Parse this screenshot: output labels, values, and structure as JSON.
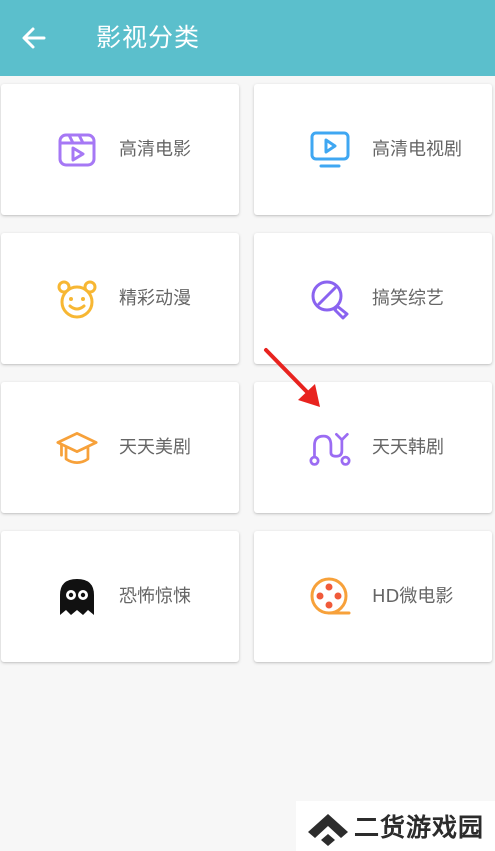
{
  "header": {
    "title": "影视分类",
    "back_icon": "arrow-left-icon",
    "bg_color": "#5bbfcc"
  },
  "categories": [
    {
      "label": "高清电影",
      "icon": "film-clapper-icon",
      "color": "#a678f5"
    },
    {
      "label": "高清电视剧",
      "icon": "tv-play-icon",
      "color": "#3fa7f2"
    },
    {
      "label": "精彩动漫",
      "icon": "bear-face-icon",
      "color": "#f7b733"
    },
    {
      "label": "搞笑综艺",
      "icon": "magnifier-tag-icon",
      "color": "#8a63f0"
    },
    {
      "label": "天天美剧",
      "icon": "graduation-cap-icon",
      "color": "#f7a13a"
    },
    {
      "label": "天天韩剧",
      "icon": "path-nodes-icon",
      "color": "#9b6cf3"
    },
    {
      "label": "恐怖惊悚",
      "icon": "ghost-icon",
      "color": "#111111"
    },
    {
      "label": "HD微电影",
      "icon": "film-reel-icon",
      "color": "#f7a13a"
    }
  ],
  "watermark": {
    "text": "二货游戏园",
    "icon": "chevron-up-logo-icon"
  },
  "annotation": {
    "icon": "red-arrow-icon",
    "color": "#e8231f"
  }
}
